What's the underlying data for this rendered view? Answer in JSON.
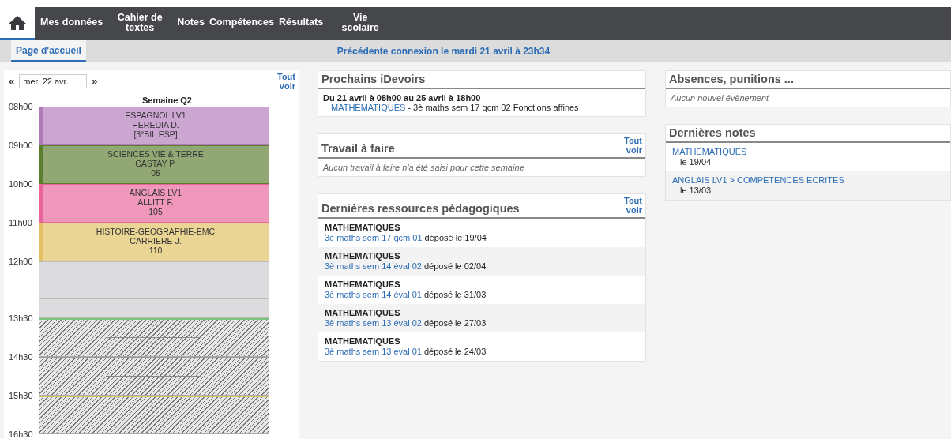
{
  "nav": {
    "home_selected": true,
    "items": [
      {
        "label": "Mes données",
        "selected": false
      },
      {
        "label": "Cahier de textes",
        "selected": false
      },
      {
        "label": "Notes",
        "selected": false
      },
      {
        "label": "Compétences",
        "selected": false
      },
      {
        "label": "Résultats",
        "selected": false
      },
      {
        "label": "Vie scolaire",
        "selected": false
      }
    ]
  },
  "tabs": [
    {
      "label": "Page d'accueil",
      "selected": true
    }
  ],
  "last_login": "Précédente connexion le mardi 21 avril à 23h34",
  "timetable": {
    "prev": "«",
    "date": "mer. 22 avr.",
    "next": "»",
    "see_all": "Tout voir",
    "week": "Semaine Q2",
    "slots": [
      {
        "kind": "course",
        "time": "08h00",
        "color": "#b07ab8",
        "subject": "ESPAGNOL LV1",
        "teacher": "HEREDIA D.",
        "room": "[3°BIL ESP]"
      },
      {
        "kind": "course",
        "time": "09h00",
        "color": "#5a7d2e",
        "subject": "SCIENCES VIE & TERRE",
        "teacher": "CASTAY P.",
        "room": "05"
      },
      {
        "kind": "course",
        "time": "10h00",
        "color": "#e8649a",
        "subject": "ANGLAIS LV1",
        "teacher": "ALLITT F.",
        "room": "105"
      },
      {
        "kind": "course",
        "time": "11h00",
        "color": "#e0c060",
        "subject": "HISTOIRE-GEOGRAPHIE-EMC",
        "teacher": "CARRIERE J.",
        "room": "110"
      },
      {
        "kind": "lunch",
        "time": "12h00"
      },
      {
        "kind": "gap"
      },
      {
        "kind": "hatched",
        "time": "13h30",
        "color": "#7cc47c"
      },
      {
        "kind": "hatched",
        "time": "14h30",
        "color": "#9a9a9a"
      },
      {
        "kind": "hatched",
        "time": "15h30",
        "color": "#d8c860"
      }
    ],
    "end_time": "16h30"
  },
  "idevoirs": {
    "title": "Prochains iDevoirs",
    "items": [
      {
        "date": "Du 21 avril à 08h00 au 25 avril à 18h00",
        "subject": "MATHEMATIQUES",
        "detail": " - 3è maths sem 17 qcm 02 Fonctions affines"
      }
    ]
  },
  "homework": {
    "title": "Travail à faire",
    "see_all": "Tout voir",
    "empty": "Aucun travail à faire n'a été saisi pour cette semaine"
  },
  "resources": {
    "title": "Dernières ressources pédagogiques",
    "see_all": "Tout voir",
    "items": [
      {
        "subject": "MATHEMATIQUES",
        "name": "3è maths sem 17 qcm 01",
        "date": "déposé le 19/04"
      },
      {
        "subject": "MATHEMATIQUES",
        "name": "3è maths sem 14 éval 02",
        "date": "déposé le 02/04"
      },
      {
        "subject": "MATHEMATIQUES",
        "name": "3è maths sem 14 éval 01",
        "date": "déposé le 31/03"
      },
      {
        "subject": "MATHEMATIQUES",
        "name": "3è maths sem 13 éval 02",
        "date": "déposé le 27/03"
      },
      {
        "subject": "MATHEMATIQUES",
        "name": "3è maths sem 13 eval 01",
        "date": "déposé le 24/03"
      }
    ]
  },
  "absences": {
    "title": "Absences, punitions ...",
    "empty": "Aucun nouvel évènement"
  },
  "grades": {
    "title": "Dernières notes",
    "items": [
      {
        "subject": "MATHEMATIQUES",
        "date": "le 19/04"
      },
      {
        "subject": "ANGLAIS LV1 > COMPETENCES ECRITES",
        "date": "le 13/03"
      }
    ]
  }
}
